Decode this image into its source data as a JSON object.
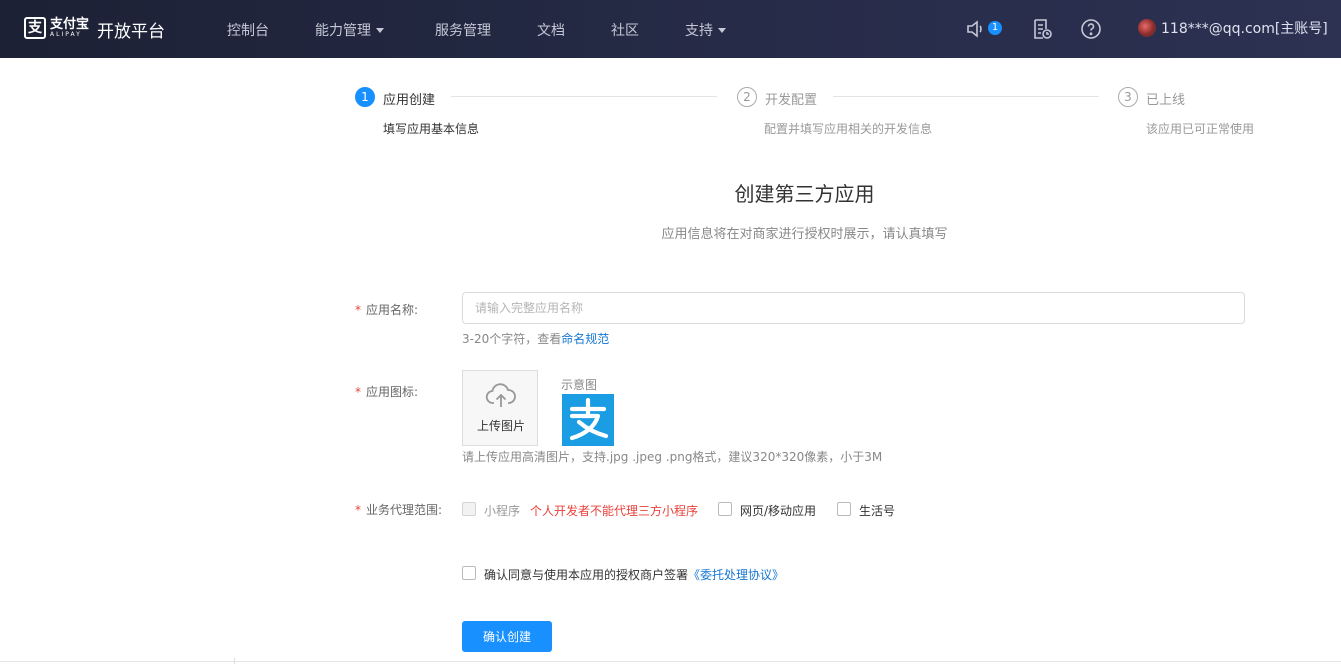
{
  "header": {
    "logo_mark": "支",
    "logo_cn": "支付宝",
    "logo_en": "ALIPAY",
    "platform": "开放平台",
    "nav": [
      {
        "label": "控制台",
        "dropdown": false
      },
      {
        "label": "能力管理",
        "dropdown": true
      },
      {
        "label": "服务管理",
        "dropdown": false
      },
      {
        "label": "文档",
        "dropdown": false
      },
      {
        "label": "社区",
        "dropdown": false
      },
      {
        "label": "支持",
        "dropdown": true
      }
    ],
    "notification_count": "1",
    "user": "118***@qq.com[主账号]"
  },
  "steps": [
    {
      "num": "1",
      "title": "应用创建",
      "desc": "填写应用基本信息",
      "state": "active"
    },
    {
      "num": "2",
      "title": "开发配置",
      "desc": "配置并填写应用相关的开发信息",
      "state": "idle"
    },
    {
      "num": "3",
      "title": "已上线",
      "desc": "该应用已可正常使用",
      "state": "idle"
    }
  ],
  "page": {
    "title": "创建第三方应用",
    "subtitle": "应用信息将在对商家进行授权时展示，请认真填写"
  },
  "form": {
    "required_mark": "*",
    "name_label": "应用名称:",
    "name_value": "",
    "name_placeholder": "请输入完整应用名称",
    "name_hint": "3-20个字符，查看",
    "name_hint_link": "命名规范",
    "icon_label": "应用图标:",
    "upload_label": "上传图片",
    "sample_label": "示意图",
    "icon_hint": "请上传应用高清图片，支持.jpg .jpeg .png格式，建议320*320像素，小于3M",
    "scope_label": "业务代理范围:",
    "scope_options": [
      {
        "label": "小程序",
        "disabled": true,
        "checked": false
      },
      {
        "label": "网页/移动应用",
        "disabled": false,
        "checked": false
      },
      {
        "label": "生活号",
        "disabled": false,
        "checked": false
      }
    ],
    "scope_warning": "个人开发者不能代理三方小程序",
    "agree_text": "确认同意与使用本应用的授权商户签署",
    "agree_link": "《委托处理协议》",
    "agree_checked": false,
    "submit_label": "确认创建"
  },
  "colors": {
    "header_bg": "#232842",
    "primary": "#1890ff",
    "link": "#1677d2",
    "danger": "#e8423b",
    "alipay_blue": "#1a9de3"
  }
}
